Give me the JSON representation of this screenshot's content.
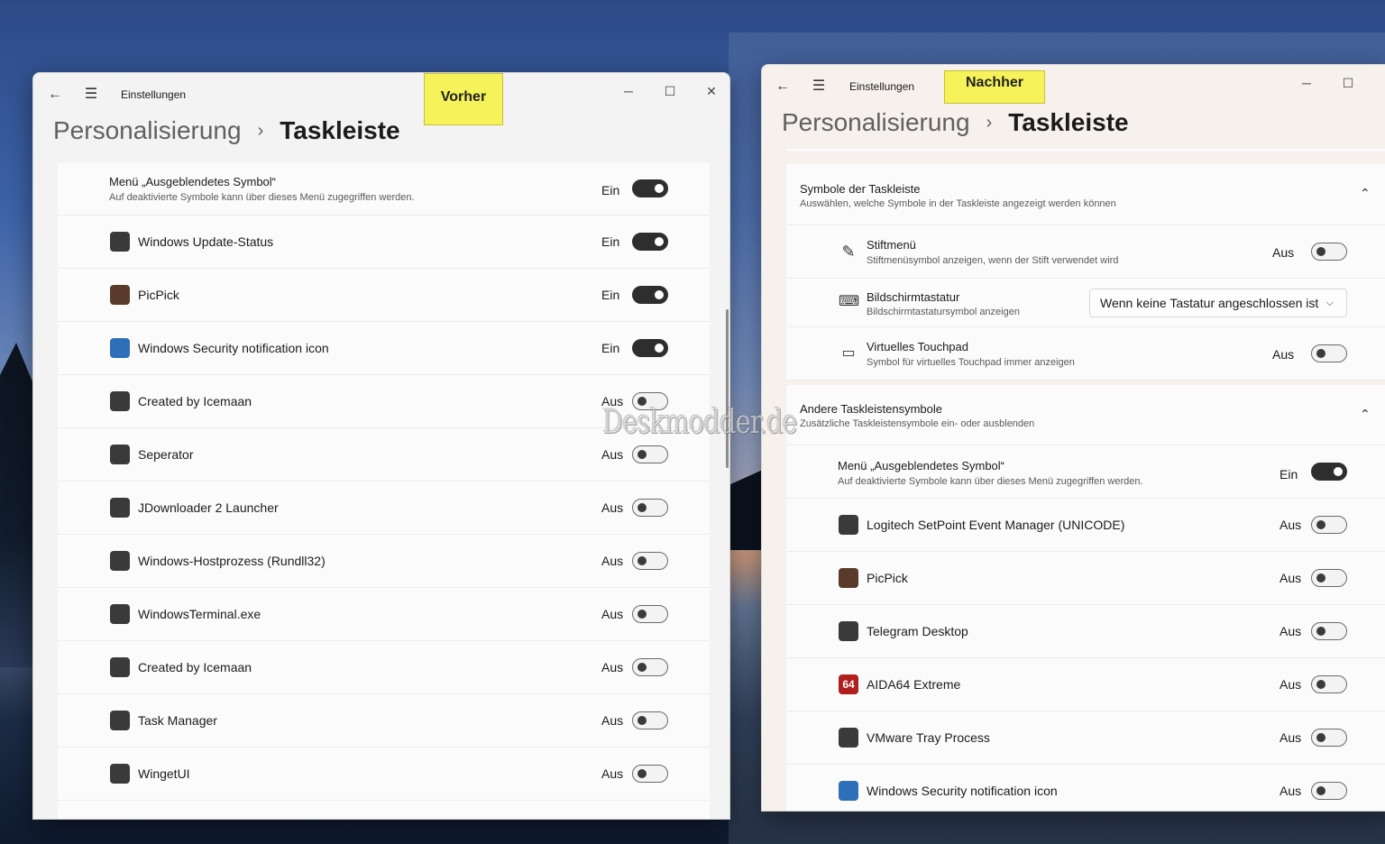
{
  "left_window": {
    "title": "Einstellungen",
    "label": "Vorher",
    "breadcrumb": {
      "parent": "Personalisierung",
      "separator": "›",
      "current": "Taskleiste"
    },
    "header_row": {
      "name": "Menü „Ausgeblendetes Symbol“",
      "description": "Auf deaktivierte Symbole kann über dieses Menü zugegriffen werden.",
      "state": "Ein",
      "on": true
    },
    "items": [
      {
        "name": "Windows Update-Status",
        "state": "Ein",
        "on": true,
        "icon": "windows-update-icon",
        "color": "#3a3a3a"
      },
      {
        "name": "PicPick",
        "state": "Ein",
        "on": true,
        "icon": "picpick-icon",
        "color": "#5a3a2a"
      },
      {
        "name": "Windows Security notification icon",
        "state": "Ein",
        "on": true,
        "icon": "shield-warning-icon",
        "color": "#2d6fb8"
      },
      {
        "name": "Created by Icemaan",
        "state": "Aus",
        "on": false,
        "icon": "icemaan-icon",
        "color": "#3a3a3a"
      },
      {
        "name": "Seperator",
        "state": "Aus",
        "on": false,
        "icon": "separator-icon",
        "color": "#3a3a3a"
      },
      {
        "name": "JDownloader 2 Launcher",
        "state": "Aus",
        "on": false,
        "icon": "jdownloader-icon",
        "color": "#3a3a3a"
      },
      {
        "name": "Windows-Hostprozess (Rundll32)",
        "state": "Aus",
        "on": false,
        "icon": "host-process-icon",
        "color": "#3a3a3a"
      },
      {
        "name": "WindowsTerminal.exe",
        "state": "Aus",
        "on": false,
        "icon": "terminal-icon",
        "color": "#3a3a3a"
      },
      {
        "name": "Created by Icemaan",
        "state": "Aus",
        "on": false,
        "icon": "icemaan-icon",
        "color": "#3a3a3a"
      },
      {
        "name": "Task Manager",
        "state": "Aus",
        "on": false,
        "icon": "task-manager-icon",
        "color": "#3a3a3a"
      },
      {
        "name": "WingetUI",
        "state": "Aus",
        "on": false,
        "icon": "wingetui-icon",
        "color": "#3a3a3a"
      }
    ]
  },
  "right_window": {
    "title": "Einstellungen",
    "label": "Nachher",
    "breadcrumb": {
      "parent": "Personalisierung",
      "separator": "›",
      "current": "Taskleiste"
    },
    "section1": {
      "title": "Symbole der Taskleiste",
      "description": "Auswählen, welche Symbole in der Taskleiste angezeigt werden können",
      "rows": [
        {
          "name": "Stiftmenü",
          "description": "Stiftmenüsymbol anzeigen, wenn der Stift verwendet wird",
          "state": "Aus",
          "icon": "pen-icon"
        },
        {
          "name": "Bildschirmtastatur",
          "description": "Bildschirmtastatursymbol anzeigen",
          "dropdown": "Wenn keine Tastatur angeschlossen ist",
          "icon": "keyboard-icon"
        },
        {
          "name": "Virtuelles Touchpad",
          "description": "Symbol für virtuelles Touchpad immer anzeigen",
          "state": "Aus",
          "icon": "touchpad-icon"
        }
      ]
    },
    "section2": {
      "title": "Andere Taskleistensymbole",
      "description": "Zusätzliche Taskleistensymbole ein- oder ausblenden",
      "header_row": {
        "name": "Menü „Ausgeblendetes Symbol“",
        "description": "Auf deaktivierte Symbole kann über dieses Menü zugegriffen werden.",
        "state": "Ein",
        "on": true
      },
      "items": [
        {
          "name": "Logitech SetPoint Event Manager (UNICODE)",
          "state": "Aus",
          "on": false,
          "icon": "logitech-icon",
          "color": "#3a3a3a"
        },
        {
          "name": "PicPick",
          "state": "Aus",
          "on": false,
          "icon": "picpick-icon",
          "color": "#5a3a2a"
        },
        {
          "name": "Telegram Desktop",
          "state": "Aus",
          "on": false,
          "icon": "telegram-icon",
          "color": "#3a3a3a"
        },
        {
          "name": "AIDA64 Extreme",
          "state": "Aus",
          "on": false,
          "icon": "aida64-icon",
          "color": "#b01e1e",
          "glyph": "64"
        },
        {
          "name": "VMware Tray Process",
          "state": "Aus",
          "on": false,
          "icon": "vmware-icon",
          "color": "#3a3a3a"
        },
        {
          "name": "Windows Security notification icon",
          "state": "Aus",
          "on": false,
          "icon": "shield-check-icon",
          "color": "#2d6fb8"
        }
      ]
    }
  },
  "watermark": "Deskmodder.de"
}
